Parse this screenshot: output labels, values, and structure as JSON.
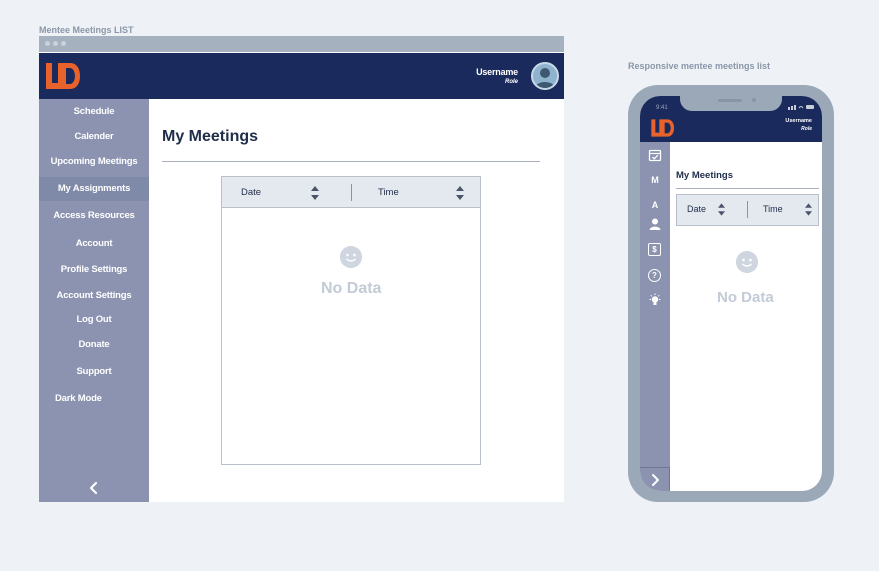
{
  "captions": {
    "desktop": "Mentee Meetings LIST",
    "mobile": "Responsive mentee meetings list"
  },
  "colors": {
    "header": "#1b2a5c",
    "sidebar": "#8b93b0",
    "brand_orange": "#e8632b",
    "frame": "#9ba8b8"
  },
  "header": {
    "logo": "UD-logo",
    "username": "Username",
    "role": "Role"
  },
  "sidebar": {
    "items": [
      {
        "label": "Schedule"
      },
      {
        "label": "Calender"
      },
      {
        "label": "Upcoming Meetings"
      },
      {
        "label": "My Assignments"
      },
      {
        "label": "Access Resources"
      },
      {
        "label": "Account"
      },
      {
        "label": "Profile Settings"
      },
      {
        "label": "Account Settings"
      },
      {
        "label": "Log Out"
      },
      {
        "label": "Donate"
      },
      {
        "label": "Support"
      },
      {
        "label": "Dark Mode"
      }
    ],
    "collapse_icon": "chevron-left-icon"
  },
  "main": {
    "title": "My Meetings",
    "table": {
      "columns": [
        "Date",
        "Time"
      ],
      "empty_text": "No Data",
      "empty_icon": "smiley-icon"
    }
  },
  "mobile": {
    "clock": "9:41",
    "title": "My Meetings",
    "columns": [
      "Date",
      "Time"
    ],
    "empty_text": "No Data",
    "sidebar_icons": [
      {
        "icon": "calendar-check-icon",
        "text": ""
      },
      {
        "icon": "letter-m-icon",
        "text": "M"
      },
      {
        "icon": "letter-a-icon",
        "text": "A"
      },
      {
        "icon": "user-icon",
        "text": ""
      },
      {
        "icon": "dollar-icon",
        "text": "$"
      },
      {
        "icon": "help-icon",
        "text": "?"
      },
      {
        "icon": "lightbulb-icon",
        "text": ""
      }
    ],
    "expand_icon": "chevron-right-icon"
  }
}
